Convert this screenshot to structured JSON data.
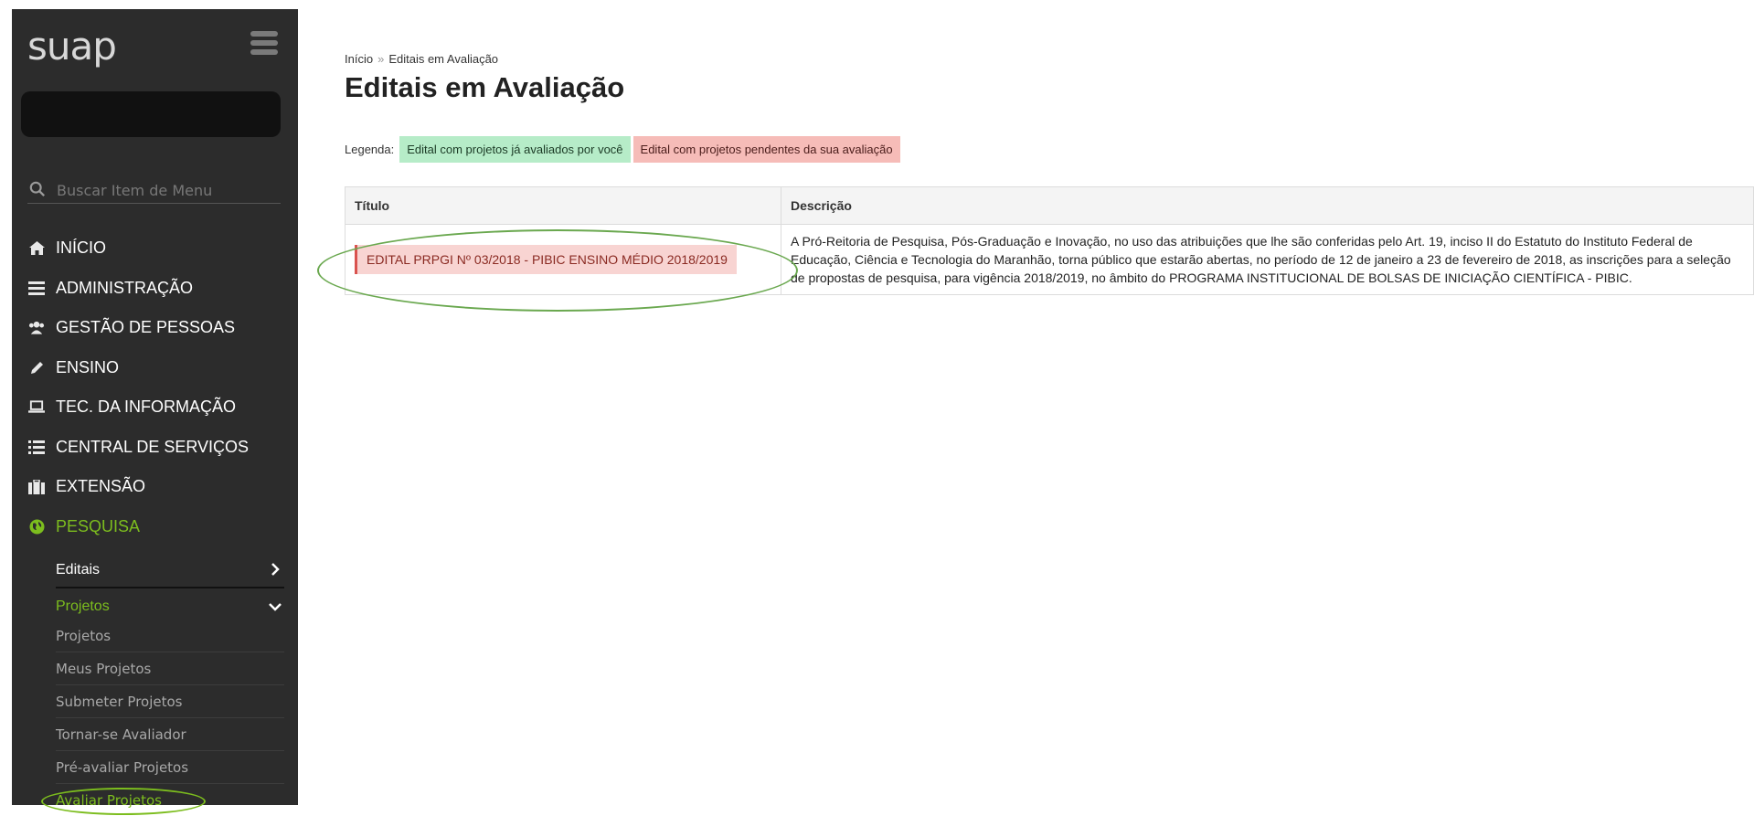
{
  "app": {
    "logo": "suap"
  },
  "search": {
    "placeholder": "Buscar Item de Menu"
  },
  "menu": {
    "items": [
      {
        "label": "INÍCIO",
        "icon": "home-icon"
      },
      {
        "label": "ADMINISTRAÇÃO",
        "icon": "admin-icon"
      },
      {
        "label": "GESTÃO DE PESSOAS",
        "icon": "people-icon"
      },
      {
        "label": "ENSINO",
        "icon": "pencil-icon"
      },
      {
        "label": "TEC. DA INFORMAÇÃO",
        "icon": "laptop-icon"
      },
      {
        "label": "CENTRAL DE SERVIÇOS",
        "icon": "list-icon"
      },
      {
        "label": "EXTENSÃO",
        "icon": "briefcase-icon"
      },
      {
        "label": "PESQUISA",
        "icon": "globe-icon"
      }
    ],
    "editais": "Editais",
    "projetos": "Projetos",
    "projetos_items": [
      "Projetos",
      "Meus Projetos",
      "Submeter Projetos",
      "Tornar-se Avaliador",
      "Pré-avaliar Projetos",
      "Avaliar Projetos"
    ]
  },
  "breadcrumb": {
    "home": "Início",
    "separator": "»",
    "current": "Editais em Avaliação"
  },
  "page": {
    "title": "Editais em Avaliação"
  },
  "legend": {
    "label": "Legenda:",
    "green": "Edital com projetos já avaliados por você",
    "red": "Edital com projetos pendentes da sua avaliação",
    "green_color": "#b6ecc8",
    "red_color": "#f6bcb8"
  },
  "table": {
    "headers": {
      "titulo": "Título",
      "descricao": "Descrição"
    },
    "rows": [
      {
        "titulo": "EDITAL PRPGI Nº 03/2018 - PIBIC ENSINO MÉDIO 2018/2019",
        "descricao": "A Pró-Reitoria de Pesquisa, Pós-Graduação e Inovação, no uso das atribuições que lhe são conferidas pelo Art. 19, inciso II do Estatuto do Instituto Federal de Educação, Ciência e Tecnologia do Maranhão, torna público que estarão abertas, no período de 12 de janeiro a 23 de fevereiro de 2018, as inscrições para a seleção de propostas de pesquisa, para vigência 2018/2019, no âmbito do PROGRAMA INSTITUCIONAL DE BOLSAS DE INICIAÇÃO CIENTÍFICA - PIBIC."
      }
    ]
  },
  "colors": {
    "accent": "#7cbd1e",
    "sidebar": "#2c2c2c"
  }
}
